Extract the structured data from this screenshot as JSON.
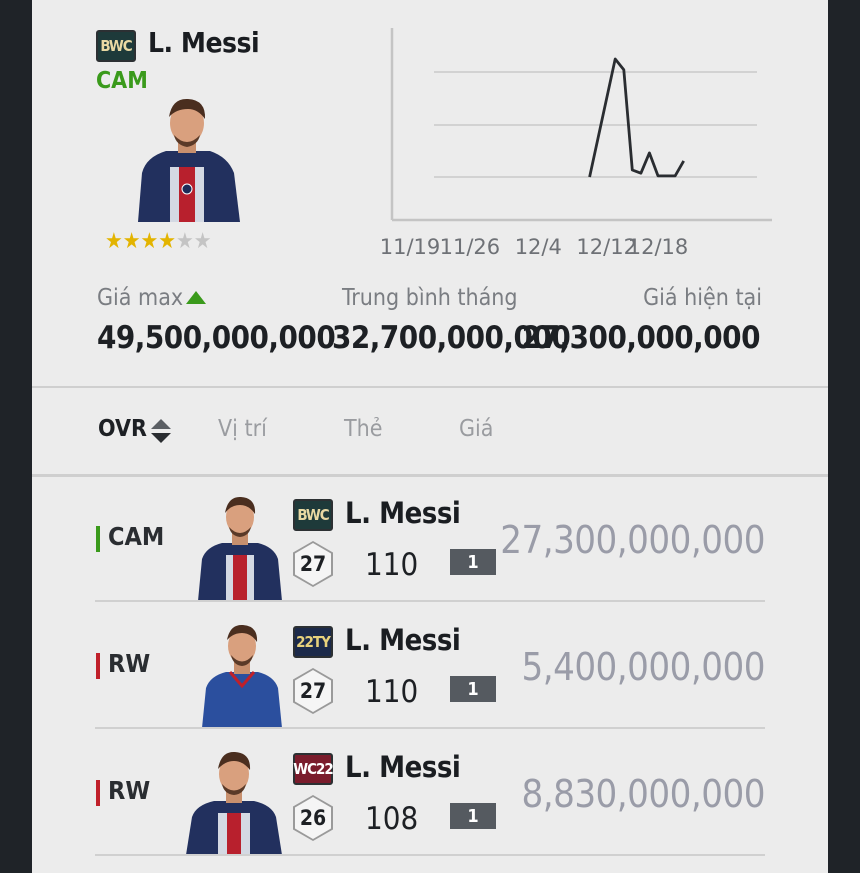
{
  "header": {
    "badge": "BWC",
    "name": "L. Messi",
    "position": "CAM",
    "stars_filled": 4,
    "stars_total": 6,
    "star_glyph": "★"
  },
  "chart_data": {
    "type": "line",
    "x_tick_labels": [
      "11/19",
      "11/26",
      "12/4",
      "12/12",
      "12/18"
    ],
    "series": [
      {
        "values": [
          {
            "x": "12/10",
            "y": 27.5
          },
          {
            "x": "12/13",
            "y": 49.5
          },
          {
            "x": "12/14",
            "y": 47.5
          },
          {
            "x": "12/15",
            "y": 28.8
          },
          {
            "x": "12/16",
            "y": 28.2
          },
          {
            "x": "12/17",
            "y": 32.0
          },
          {
            "x": "12/18",
            "y": 27.7
          },
          {
            "x": "12/20",
            "y": 27.7
          },
          {
            "x": "12/21",
            "y": 30.5
          }
        ]
      }
    ],
    "grid": true,
    "color": "#2a2d31"
  },
  "stats": {
    "max_label": "Giá max",
    "max_value": "49,500,000,000",
    "avg_label": "Trung bình tháng",
    "avg_value": "32,700,000,000",
    "current_label": "Giá hiện tại",
    "current_value": "27,300,000,000",
    "up_color": "#3a9a1b"
  },
  "sort_bar": {
    "ovr": "OVR",
    "position": "Vị trí",
    "card": "Thẻ",
    "price": "Giá"
  },
  "rows": [
    {
      "position": "CAM",
      "pos_color": "#3a9a1b",
      "badge": "BWC",
      "name": "L. Messi",
      "level": "27",
      "ovr": "110",
      "grade": "1",
      "price": "27,300,000,000"
    },
    {
      "position": "RW",
      "pos_color": "#c0202a",
      "badge": "22TY",
      "name": "L. Messi",
      "level": "27",
      "ovr": "110",
      "grade": "1",
      "price": "5,400,000,000"
    },
    {
      "position": "RW",
      "pos_color": "#c0202a",
      "badge": "WC22",
      "name": "L. Messi",
      "level": "26",
      "ovr": "108",
      "grade": "1",
      "price": "8,830,000,000"
    }
  ]
}
